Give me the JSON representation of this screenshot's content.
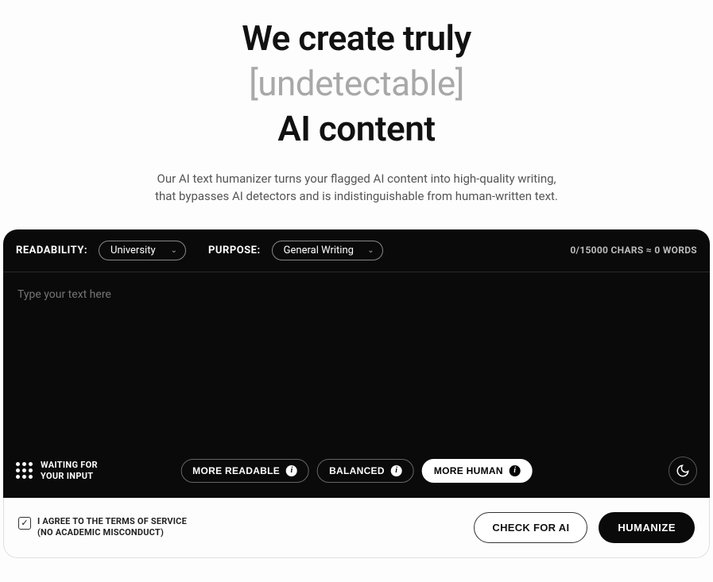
{
  "hero": {
    "title_line1": "We create truly",
    "title_highlight": "[undetectable]",
    "title_line3": "AI content",
    "subtitle_line1": "Our AI text humanizer turns your flagged AI content into high-quality writing,",
    "subtitle_line2": "that bypasses AI detectors and is indistinguishable from human-written text."
  },
  "toolbar": {
    "readability_label": "READABILITY:",
    "readability_value": "University",
    "purpose_label": "PURPOSE:",
    "purpose_value": "General Writing",
    "char_count": "0/15000 CHARS ≈ 0 WORDS"
  },
  "editor": {
    "placeholder": "Type your text here"
  },
  "modebar": {
    "waiting_line1": "WAITING FOR",
    "waiting_line2": "YOUR INPUT",
    "more_readable": "MORE READABLE",
    "balanced": "BALANCED",
    "more_human": "MORE HUMAN"
  },
  "footer": {
    "tos_line1": "I AGREE TO THE TERMS OF SERVICE",
    "tos_line2": "(NO ACADEMIC MISCONDUCT)",
    "check_button": "CHECK FOR AI",
    "humanize_button": "HUMANIZE",
    "tos_checked": true
  }
}
